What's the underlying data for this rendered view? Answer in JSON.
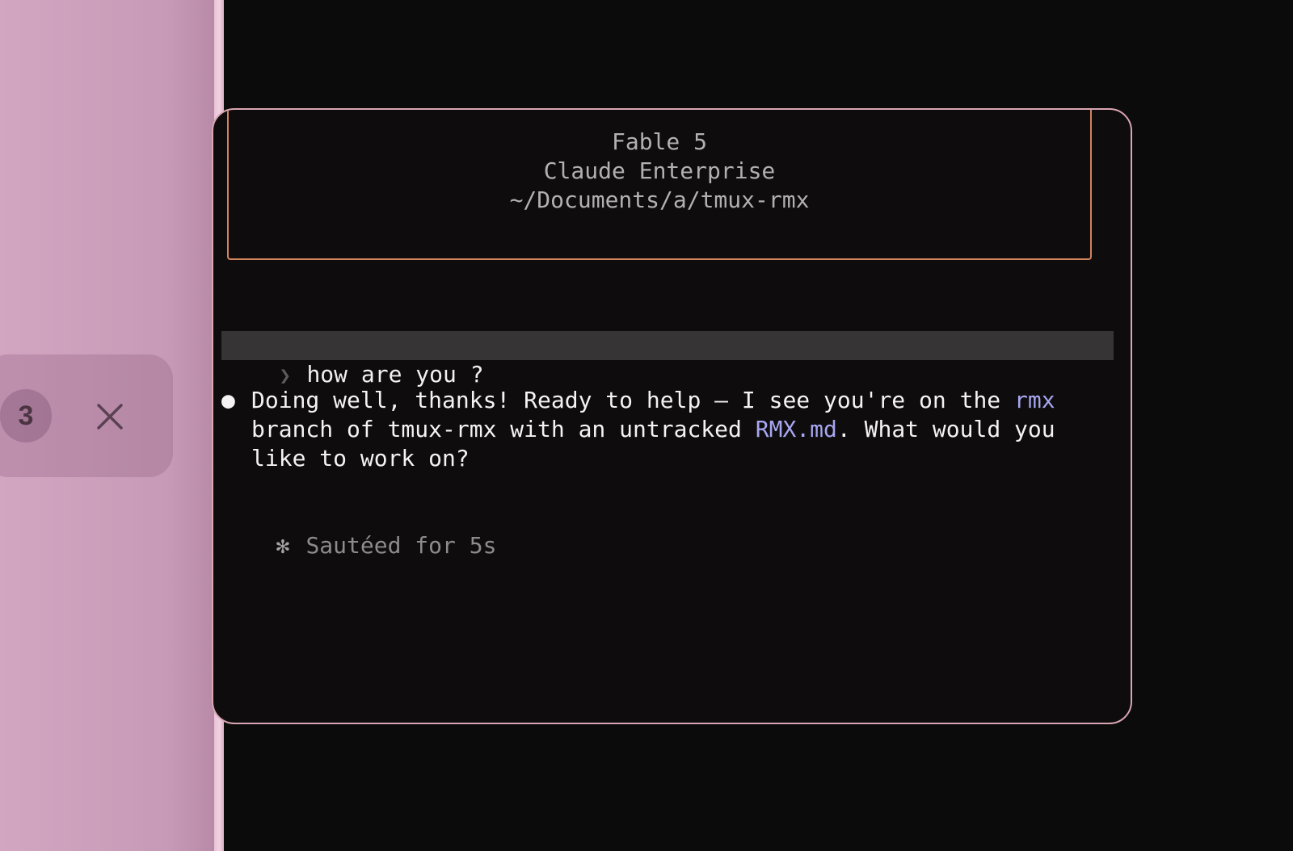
{
  "sidebar": {
    "badge_count": "3",
    "close_icon": "close-icon"
  },
  "terminal": {
    "header": {
      "title": "Fable 5",
      "subtitle": "Claude Enterprise",
      "path": "~/Documents/a/tmux-rmx"
    },
    "prompt": {
      "chevron": "❯",
      "text": "how are you ?"
    },
    "reply": {
      "bullet": "●",
      "segments": [
        {
          "text": "Doing well, thanks! Ready to help — I see you're on the ",
          "accent": false
        },
        {
          "text": "rmx",
          "accent": true
        },
        {
          "text": "\nbranch of tmux-rmx with an untracked ",
          "accent": false
        },
        {
          "text": "RMX.md",
          "accent": true
        },
        {
          "text": ". What would you\nlike to work on?",
          "accent": false
        }
      ]
    },
    "status": {
      "icon": "✻",
      "text": "Sautéed for 5s"
    }
  },
  "colors": {
    "sidebar_pink": "#c99db9",
    "window_border": "#d9a6b3",
    "header_border": "#d1855c",
    "accent_blue": "#a7a6f0",
    "background": "#0c0b0c"
  }
}
